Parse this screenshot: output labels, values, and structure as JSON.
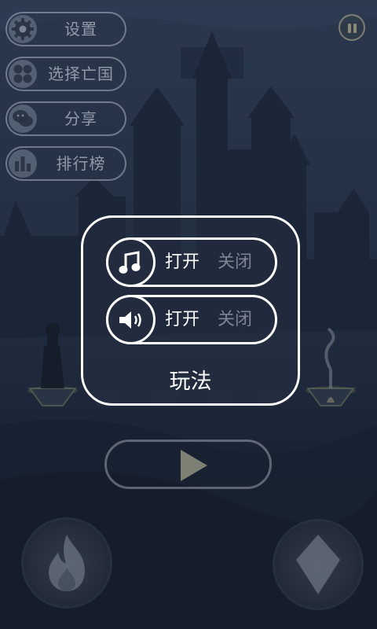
{
  "menu": {
    "settings_label": "设置",
    "select_country_label": "选择亡国",
    "share_label": "分享",
    "leaderboard_label": "排行榜"
  },
  "dialog": {
    "music": {
      "on_label": "打开",
      "off_label": "关闭",
      "icon": "music-note-icon"
    },
    "sound": {
      "on_label": "打开",
      "off_label": "关闭",
      "icon": "speaker-icon"
    },
    "howto_label": "玩法"
  },
  "controls": {
    "play_icon": "play-icon",
    "fire_icon": "fire-icon",
    "gem_icon": "diamond-icon",
    "pause_icon": "pause-icon"
  },
  "colors": {
    "dialog_border": "#ffffff",
    "background": "#2b3a52",
    "menu_text": "#d7dee8"
  }
}
